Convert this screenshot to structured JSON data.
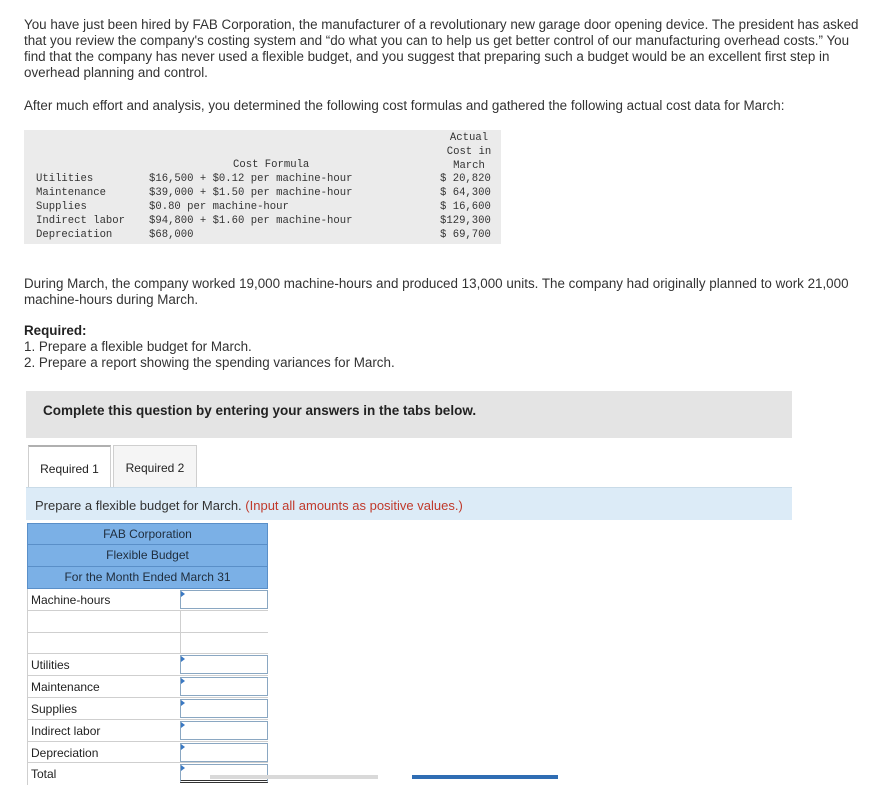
{
  "intro": "You have just been hired by FAB Corporation, the manufacturer of a revolutionary new garage door opening device. The president has asked that you review the company's costing system and “do what you can to help us get better control of our manufacturing overhead costs.” You find that the company has never used a flexible budget, and you suggest that preparing such a budget would be an excellent first step in overhead planning and control.",
  "after_effort": "After much effort and analysis, you determined the following cost formulas and gathered the following actual cost data for March:",
  "cost_table": {
    "formula_header": "Cost Formula",
    "actual_header": [
      "Actual",
      "Cost in",
      "March"
    ],
    "rows": [
      {
        "name": "Utilities",
        "formula": "$16,500 + $0.12 per machine-hour",
        "actual": "$ 20,820"
      },
      {
        "name": "Maintenance",
        "formula": "$39,000 + $1.50 per machine-hour",
        "actual": "$ 64,300"
      },
      {
        "name": "Supplies",
        "formula": "$0.80 per machine-hour",
        "actual": "$ 16,600"
      },
      {
        "name": "Indirect labor",
        "formula": "$94,800 + $1.60 per machine-hour",
        "actual": "$129,300"
      },
      {
        "name": "Depreciation",
        "formula": "$68,000",
        "actual": "$ 69,700"
      }
    ]
  },
  "march_para": "During March, the company worked 19,000 machine-hours and produced 13,000 units. The company had originally planned to work 21,000 machine-hours during March.",
  "required": {
    "title": "Required:",
    "items": [
      "1. Prepare a flexible budget for March.",
      "2. Prepare a report showing the spending variances for March."
    ]
  },
  "complete_bar": "Complete this question by entering your answers in the tabs below.",
  "tabs": [
    "Required 1",
    "Required 2"
  ],
  "prompt": {
    "main": "Prepare a flexible budget for March.",
    "note": "(Input all amounts as positive values.)"
  },
  "budget": {
    "company": "FAB Corporation",
    "title": "Flexible Budget",
    "period": "For the Month Ended March 31",
    "machine_hours_label": "Machine-hours",
    "rows": [
      "Utilities",
      "Maintenance",
      "Supplies",
      "Indirect labor",
      "Depreciation"
    ],
    "total_label": "Total"
  }
}
